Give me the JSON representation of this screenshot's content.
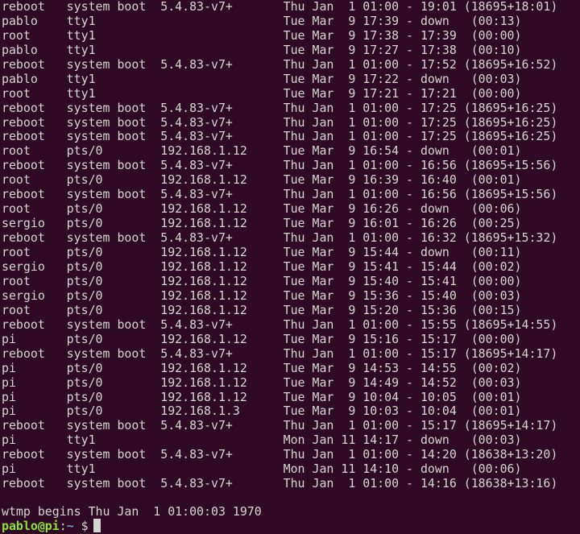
{
  "terminal": {
    "lines": [
      "reboot   system boot  5.4.83-v7+       Thu Jan  1 01:00 - 19:01 (18695+18:01)",
      "pablo    tty1                          Tue Mar  9 17:39 - down   (00:13)",
      "root     tty1                          Tue Mar  9 17:38 - 17:39  (00:00)",
      "pablo    tty1                          Tue Mar  9 17:27 - 17:38  (00:10)",
      "reboot   system boot  5.4.83-v7+       Thu Jan  1 01:00 - 17:52 (18695+16:52)",
      "pablo    tty1                          Tue Mar  9 17:22 - down   (00:03)",
      "root     tty1                          Tue Mar  9 17:21 - 17:21  (00:00)",
      "reboot   system boot  5.4.83-v7+       Thu Jan  1 01:00 - 17:25 (18695+16:25)",
      "reboot   system boot  5.4.83-v7+       Thu Jan  1 01:00 - 17:25 (18695+16:25)",
      "reboot   system boot  5.4.83-v7+       Thu Jan  1 01:00 - 17:25 (18695+16:25)",
      "root     pts/0        192.168.1.12     Tue Mar  9 16:54 - down   (00:01)",
      "reboot   system boot  5.4.83-v7+       Thu Jan  1 01:00 - 16:56 (18695+15:56)",
      "root     pts/0        192.168.1.12     Tue Mar  9 16:39 - 16:40  (00:01)",
      "reboot   system boot  5.4.83-v7+       Thu Jan  1 01:00 - 16:56 (18695+15:56)",
      "root     pts/0        192.168.1.12     Tue Mar  9 16:26 - down   (00:06)",
      "sergio   pts/0        192.168.1.12     Tue Mar  9 16:01 - 16:26  (00:25)",
      "reboot   system boot  5.4.83-v7+       Thu Jan  1 01:00 - 16:32 (18695+15:32)",
      "root     pts/0        192.168.1.12     Tue Mar  9 15:44 - down   (00:11)",
      "sergio   pts/0        192.168.1.12     Tue Mar  9 15:41 - 15:44  (00:02)",
      "root     pts/0        192.168.1.12     Tue Mar  9 15:40 - 15:41  (00:00)",
      "sergio   pts/0        192.168.1.12     Tue Mar  9 15:36 - 15:40  (00:03)",
      "root     pts/0        192.168.1.12     Tue Mar  9 15:20 - 15:36  (00:15)",
      "reboot   system boot  5.4.83-v7+       Thu Jan  1 01:00 - 15:55 (18695+14:55)",
      "pi       pts/0        192.168.1.12     Tue Mar  9 15:16 - 15:17  (00:00)",
      "reboot   system boot  5.4.83-v7+       Thu Jan  1 01:00 - 15:17 (18695+14:17)",
      "pi       pts/0        192.168.1.12     Tue Mar  9 14:53 - 14:55  (00:02)",
      "pi       pts/0        192.168.1.12     Tue Mar  9 14:49 - 14:52  (00:03)",
      "pi       pts/0        192.168.1.12     Tue Mar  9 10:04 - 10:05  (00:01)",
      "pi       pts/0        192.168.1.3      Tue Mar  9 10:03 - 10:04  (00:01)",
      "reboot   system boot  5.4.83-v7+       Thu Jan  1 01:00 - 15:17 (18695+14:17)",
      "pi       tty1                          Mon Jan 11 14:17 - down   (00:03)",
      "reboot   system boot  5.4.83-v7+       Thu Jan  1 01:00 - 14:20 (18638+13:20)",
      "pi       tty1                          Mon Jan 11 14:10 - down   (00:06)",
      "reboot   system boot  5.4.83-v7+       Thu Jan  1 01:00 - 14:16 (18638+13:16)"
    ],
    "footer": "wtmp begins Thu Jan  1 01:00:03 1970",
    "prompt": {
      "user_host": "pablo@pi",
      "separator": ":",
      "path": "~",
      "symbol": " $"
    },
    "colors": {
      "background": "#300a24",
      "foreground": "#d3d7cf",
      "prompt_user": "#8ae234",
      "prompt_path": "#729fcf"
    }
  }
}
